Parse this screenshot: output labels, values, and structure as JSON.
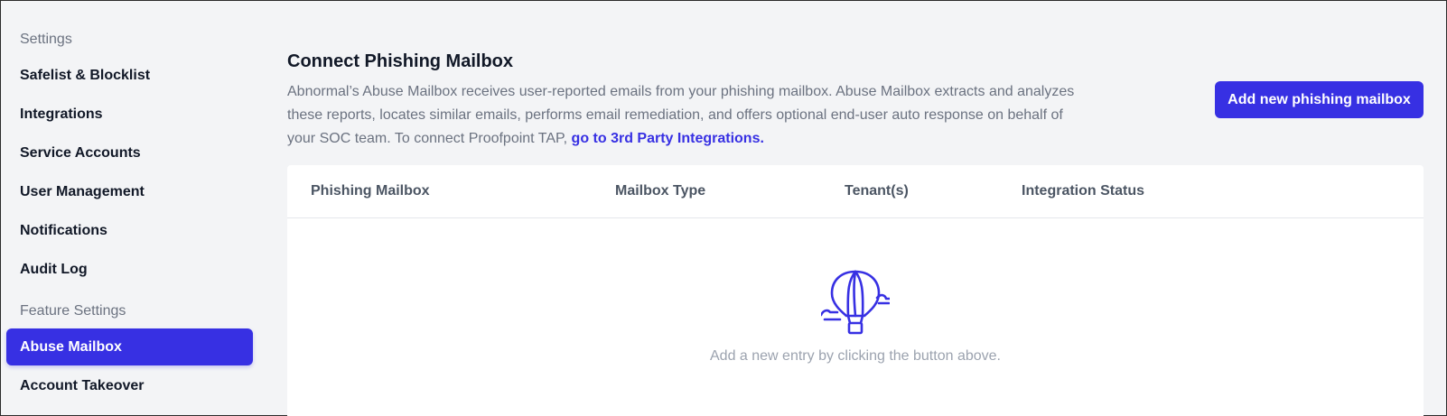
{
  "sidebar": {
    "settings_header": "Settings",
    "items": [
      {
        "label": "Safelist & Blocklist"
      },
      {
        "label": "Integrations"
      },
      {
        "label": "Service Accounts"
      },
      {
        "label": "User Management"
      },
      {
        "label": "Notifications"
      },
      {
        "label": "Audit Log"
      }
    ],
    "feature_header": "Feature Settings",
    "feature_items": [
      {
        "label": "Abuse Mailbox",
        "active": true
      },
      {
        "label": "Account Takeover"
      }
    ]
  },
  "main": {
    "title": "Connect Phishing Mailbox",
    "description": "Abnormal’s Abuse Mailbox receives user-reported emails from your phishing mailbox. Abuse Mailbox extracts and analyzes these reports, locates similar emails, performs email remediation, and offers optional end-user auto response on behalf of your SOC team. To connect Proofpoint TAP, ",
    "description_link": "go to 3rd Party Integrations.",
    "add_button": "Add new phishing mailbox",
    "table": {
      "columns": [
        "Phishing Mailbox",
        "Mailbox Type",
        "Tenant(s)",
        "Integration Status"
      ]
    },
    "empty_state": {
      "icon": "hot-air-balloon-icon",
      "text": "Add a new entry by clicking the button above."
    }
  },
  "colors": {
    "accent": "#3730e3",
    "background": "#f3f4f6",
    "muted_text": "#6b7280"
  }
}
